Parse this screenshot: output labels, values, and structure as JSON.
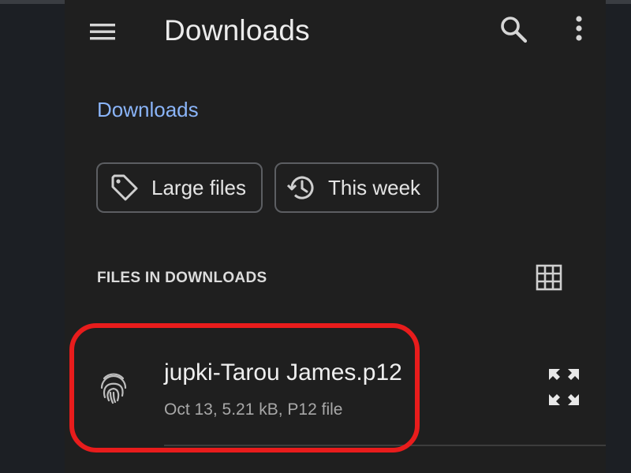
{
  "appbar": {
    "title": "Downloads",
    "menu_icon": "hamburger-menu-icon",
    "search_icon": "search-icon",
    "more_icon": "more-vertical-icon"
  },
  "breadcrumb": {
    "label": "Downloads"
  },
  "chips": [
    {
      "label": "Large files",
      "icon": "tag-icon"
    },
    {
      "label": "This week",
      "icon": "history-icon"
    }
  ],
  "section": {
    "header": "FILES IN DOWNLOADS",
    "view_icon": "grid-view-icon"
  },
  "files": [
    {
      "name": "jupki-Tarou James.p12",
      "meta": "Oct 13, 5.21 kB, P12 file",
      "icon": "fingerprint-icon",
      "action_icon": "expand-icon"
    }
  ],
  "colors": {
    "background": "#1f1f1f",
    "accent": "#8ab4f8",
    "highlight": "#e81c1c",
    "chip_border": "#5c5e62"
  }
}
